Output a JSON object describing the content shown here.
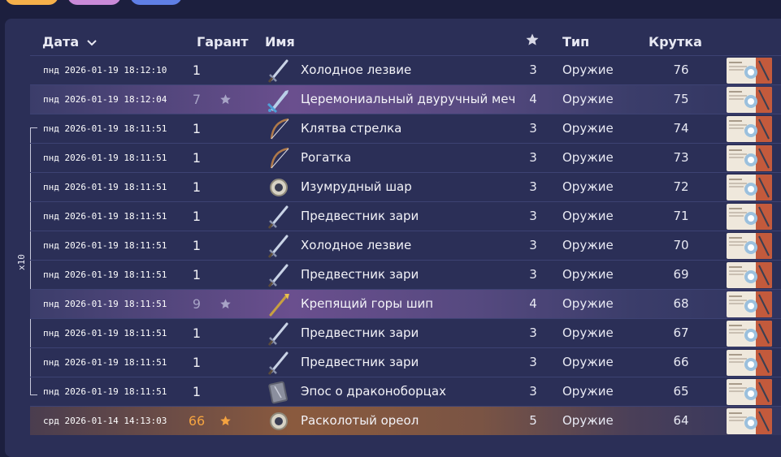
{
  "header": {
    "date_label": "Дата",
    "pity_label": "Гарант",
    "name_label": "Имя",
    "type_label": "Тип",
    "roll_label": "Крутка"
  },
  "multi_label": "x10",
  "rows": [
    {
      "date": "пнд 2026-01-19 18:12:10",
      "pity": "1",
      "name": "Холодное лезвие",
      "rarity": "3",
      "type": "Оружие",
      "roll": "76",
      "weapon_icon": "sword-icon"
    },
    {
      "date": "пнд 2026-01-19 18:12:04",
      "pity": "7",
      "name": "Церемониальный двуручный меч",
      "rarity": "4",
      "type": "Оружие",
      "roll": "75",
      "weapon_icon": "claymore-icon"
    },
    {
      "date": "пнд 2026-01-19 18:11:51",
      "pity": "1",
      "name": "Клятва стрелка",
      "rarity": "3",
      "type": "Оружие",
      "roll": "74",
      "weapon_icon": "bow-icon"
    },
    {
      "date": "пнд 2026-01-19 18:11:51",
      "pity": "1",
      "name": "Рогатка",
      "rarity": "3",
      "type": "Оружие",
      "roll": "73",
      "weapon_icon": "bow-icon"
    },
    {
      "date": "пнд 2026-01-19 18:11:51",
      "pity": "1",
      "name": "Изумрудный шар",
      "rarity": "3",
      "type": "Оружие",
      "roll": "72",
      "weapon_icon": "catalyst-icon"
    },
    {
      "date": "пнд 2026-01-19 18:11:51",
      "pity": "1",
      "name": "Предвестник зари",
      "rarity": "3",
      "type": "Оружие",
      "roll": "71",
      "weapon_icon": "sword-icon"
    },
    {
      "date": "пнд 2026-01-19 18:11:51",
      "pity": "1",
      "name": "Холодное лезвие",
      "rarity": "3",
      "type": "Оружие",
      "roll": "70",
      "weapon_icon": "sword-icon"
    },
    {
      "date": "пнд 2026-01-19 18:11:51",
      "pity": "1",
      "name": "Предвестник зари",
      "rarity": "3",
      "type": "Оружие",
      "roll": "69",
      "weapon_icon": "sword-icon"
    },
    {
      "date": "пнд 2026-01-19 18:11:51",
      "pity": "9",
      "name": "Крепящий горы шип",
      "rarity": "4",
      "type": "Оружие",
      "roll": "68",
      "weapon_icon": "polearm-icon"
    },
    {
      "date": "пнд 2026-01-19 18:11:51",
      "pity": "1",
      "name": "Предвестник зари",
      "rarity": "3",
      "type": "Оружие",
      "roll": "67",
      "weapon_icon": "sword-icon"
    },
    {
      "date": "пнд 2026-01-19 18:11:51",
      "pity": "1",
      "name": "Предвестник зари",
      "rarity": "3",
      "type": "Оружие",
      "roll": "66",
      "weapon_icon": "sword-icon"
    },
    {
      "date": "пнд 2026-01-19 18:11:51",
      "pity": "1",
      "name": "Эпос о драконоборцах",
      "rarity": "3",
      "type": "Оружие",
      "roll": "65",
      "weapon_icon": "book-icon"
    },
    {
      "date": "срд 2026-01-14 14:13:03",
      "pity": "66",
      "name": "Расколотый ореол",
      "rarity": "5",
      "type": "Оружие",
      "roll": "64",
      "weapon_icon": "catalyst-icon"
    }
  ],
  "colors": {
    "background": "#1c1f3e",
    "panel": "#2b2f57",
    "four_star": "#a7a3c6",
    "five_star": "#f4a340"
  }
}
